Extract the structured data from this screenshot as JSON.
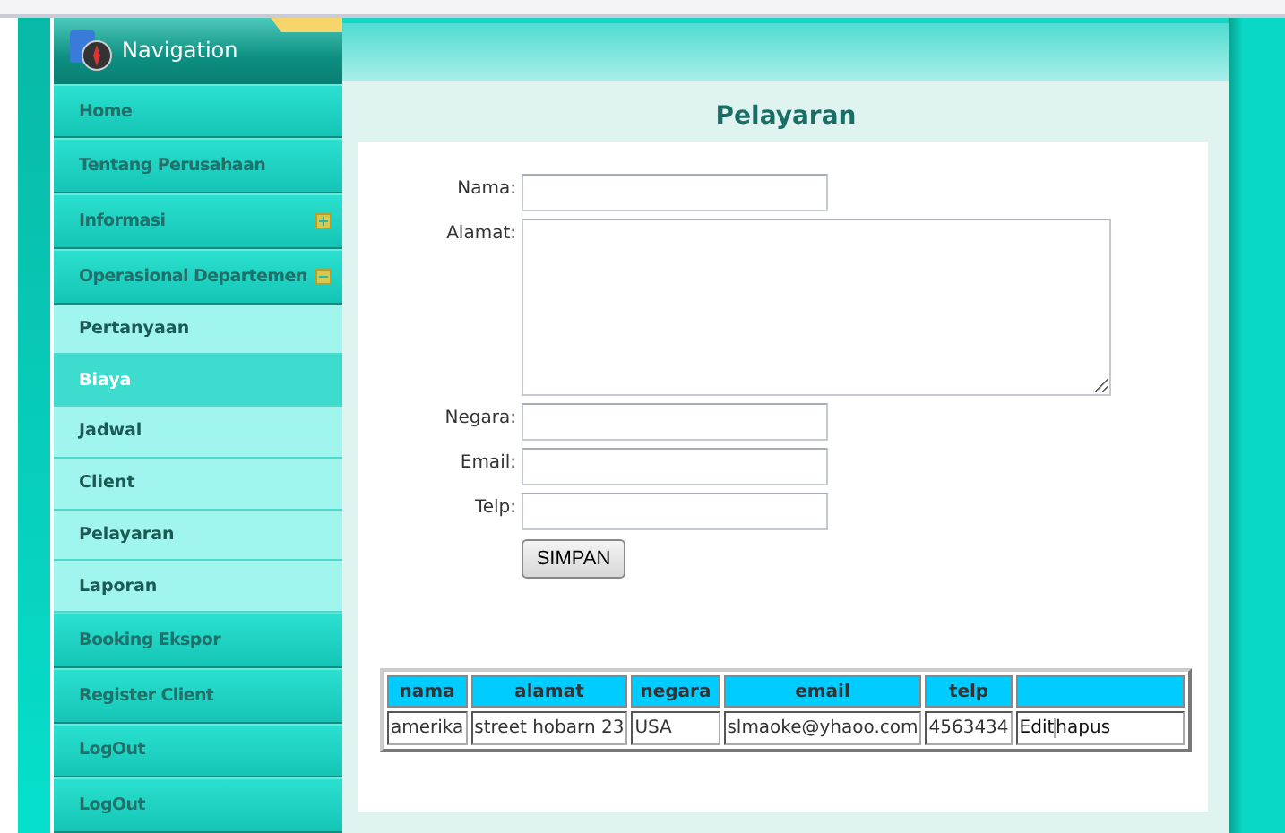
{
  "sidebar": {
    "title": "Navigation",
    "items": [
      {
        "label": "Home"
      },
      {
        "label": "Tentang Perusahaan"
      },
      {
        "label": "Informasi",
        "expanded": false
      },
      {
        "label": "Operasional Departemen",
        "expanded": true,
        "children": [
          {
            "label": "Pertanyaan",
            "selected": false
          },
          {
            "label": "Biaya",
            "selected": true
          },
          {
            "label": "Jadwal",
            "selected": false
          },
          {
            "label": "Client",
            "selected": false
          },
          {
            "label": "Pelayaran",
            "selected": false
          },
          {
            "label": "Laporan",
            "selected": false
          }
        ]
      },
      {
        "label": "Booking Ekspor"
      },
      {
        "label": "Register Client"
      },
      {
        "label": "LogOut"
      },
      {
        "label": "LogOut"
      }
    ]
  },
  "page_title": "Pelayaran",
  "form": {
    "fields": [
      {
        "label": "Nama:",
        "kind": "input"
      },
      {
        "label": "Alamat:",
        "kind": "textarea"
      },
      {
        "label": "Negara:",
        "kind": "input"
      },
      {
        "label": "Email:",
        "kind": "input"
      },
      {
        "label": "Telp:",
        "kind": "input"
      }
    ],
    "submit": "SIMPAN"
  },
  "table": {
    "columns": [
      "nama",
      "alamat",
      "negara",
      "email",
      "telp"
    ],
    "rows": [
      {
        "cells": [
          "amerika",
          "street hobarn 23",
          "USA",
          "slmaoke@yhaoo.com",
          "4563434"
        ],
        "actions": [
          "Edit",
          "hapus"
        ]
      }
    ]
  }
}
